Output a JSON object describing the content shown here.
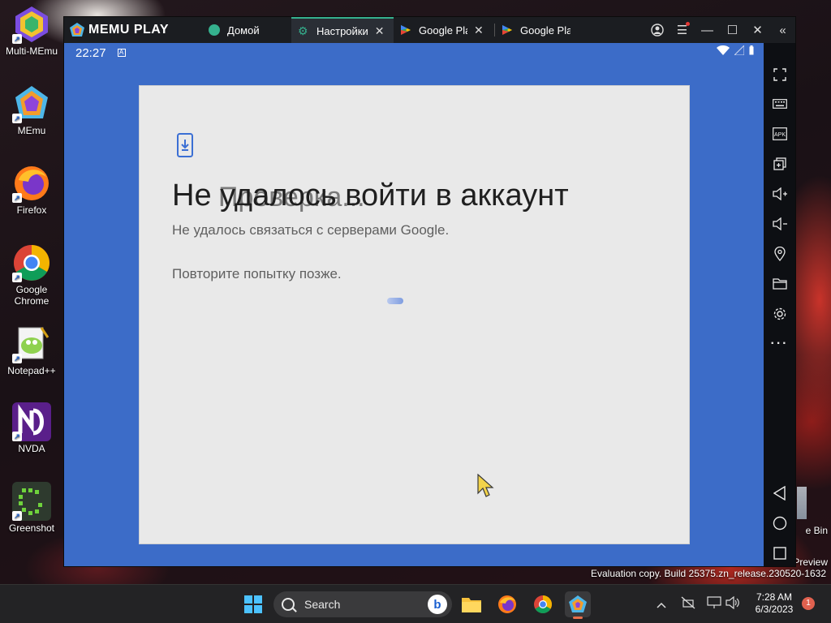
{
  "desktop": {
    "icons": [
      {
        "label": "Multi-MEmu"
      },
      {
        "label": "MEmu"
      },
      {
        "label": "Firefox"
      },
      {
        "label": "Google Chrome"
      },
      {
        "label": "Notepad++"
      },
      {
        "label": "NVDA"
      },
      {
        "label": "Greenshot"
      }
    ],
    "right_edge_labels": [
      "e Bin",
      "Preview"
    ]
  },
  "memu": {
    "brand": "MEMU PLAY",
    "tabs": [
      {
        "label": "Домой",
        "active": false,
        "closable": false
      },
      {
        "label": "Настройки",
        "active": true,
        "closable": true
      },
      {
        "label": "Google Play",
        "active": false,
        "closable": true
      },
      {
        "label": "Google Play",
        "active": false,
        "closable": false
      }
    ],
    "android_status": {
      "time": "22:27"
    },
    "sidebar_icons": [
      "fullscreen-icon",
      "keyboard-icon",
      "apk-icon",
      "multi-window-icon",
      "volume-up-icon",
      "volume-down-icon",
      "location-icon",
      "folder-icon",
      "settings-icon",
      "more-icon",
      "back-icon",
      "home-icon",
      "recents-icon"
    ]
  },
  "dialog": {
    "title": "Не удалось войти в аккаунт",
    "title_ghost": "Проверка...",
    "message": "Не удалось связаться с серверами Google.",
    "retry_message": "Повторите попытку позже."
  },
  "watermark": {
    "build": "Evaluation copy. Build 25375.zn_release.230520-1632"
  },
  "taskbar": {
    "search_placeholder": "Search",
    "time": "7:28 AM",
    "date": "6/3/2023",
    "notification_count": "1"
  },
  "colors": {
    "emulator_bg": "#3c6cc8",
    "dialog_bg": "#e9e9e9",
    "tab_active_accent": "#35b18e",
    "titlebar": "#1b1d21"
  }
}
